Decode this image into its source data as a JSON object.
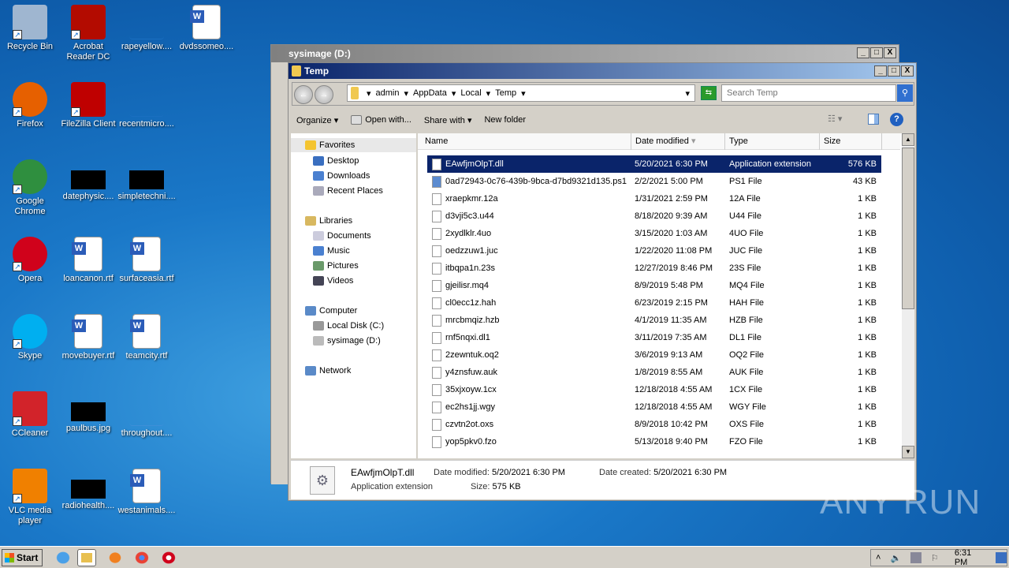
{
  "desktop": {
    "icons": [
      {
        "label": "Recycle Bin",
        "icon": "recycle-bin-icon",
        "color": "#9fb6d0"
      },
      {
        "label": "Acrobat Reader DC",
        "icon": "acrobat-icon",
        "color": "#b30b00"
      },
      {
        "label": "rapeyellow....",
        "icon": "blank-file-icon",
        "color": "#1a6fc0"
      },
      {
        "label": "dvdssomeo....",
        "icon": "word-doc-icon",
        "color": "#ffffff"
      },
      {
        "label": "Firefox",
        "icon": "firefox-icon",
        "color": "#e66000"
      },
      {
        "label": "FileZilla Client",
        "icon": "filezilla-icon",
        "color": "#bf0000"
      },
      {
        "label": "recentmicro....",
        "icon": "blank-file-icon",
        "color": "#1a6fc0"
      },
      {
        "label": "Google Chrome",
        "icon": "chrome-icon",
        "color": "#2f8f3f"
      },
      {
        "label": "datephysic....",
        "icon": "black-thumb-icon",
        "color": "#000000"
      },
      {
        "label": "simpletechni....",
        "icon": "black-thumb-icon",
        "color": "#000000"
      },
      {
        "label": "Opera",
        "icon": "opera-icon",
        "color": "#d0021b"
      },
      {
        "label": "loancanon.rtf",
        "icon": "word-doc-icon",
        "color": "#ffffff"
      },
      {
        "label": "surfaceasia.rtf",
        "icon": "word-doc-icon",
        "color": "#ffffff"
      },
      {
        "label": "Skype",
        "icon": "skype-icon",
        "color": "#00aff0"
      },
      {
        "label": "movebuyer.rtf",
        "icon": "word-doc-icon",
        "color": "#ffffff"
      },
      {
        "label": "teamcity.rtf",
        "icon": "word-doc-icon",
        "color": "#ffffff"
      },
      {
        "label": "CCleaner",
        "icon": "ccleaner-icon",
        "color": "#d2232a"
      },
      {
        "label": "paulbus.jpg",
        "icon": "black-thumb-icon",
        "color": "#000000"
      },
      {
        "label": "throughout....",
        "icon": "blank-file-icon",
        "color": "#3d8fd8"
      },
      {
        "label": "VLC media player",
        "icon": "vlc-icon",
        "color": "#f08000"
      },
      {
        "label": "radiohealth....",
        "icon": "black-thumb-icon",
        "color": "#000000"
      },
      {
        "label": "westanimals....",
        "icon": "word-doc-icon",
        "color": "#ffffff"
      }
    ]
  },
  "back_window": {
    "title": "sysimage (D:)"
  },
  "window": {
    "title": "Temp",
    "breadcrumb": [
      "admin",
      "AppData",
      "Local",
      "Temp"
    ],
    "search_placeholder": "Search Temp",
    "toolbar": {
      "organize": "Organize",
      "open_with": "Open with...",
      "share_with": "Share with",
      "new_folder": "New folder"
    },
    "nav": {
      "favorites": "Favorites",
      "desktop": "Desktop",
      "downloads": "Downloads",
      "recent": "Recent Places",
      "libraries": "Libraries",
      "documents": "Documents",
      "music": "Music",
      "pictures": "Pictures",
      "videos": "Videos",
      "computer": "Computer",
      "local_disk": "Local Disk (C:)",
      "sysimage": "sysimage (D:)",
      "network": "Network"
    },
    "columns": {
      "name": "Name",
      "date": "Date modified",
      "type": "Type",
      "size": "Size"
    },
    "files": [
      [
        "EAwfjmOlpT.dll",
        "5/20/2021 6:30 PM",
        "Application extension",
        "576 KB"
      ],
      [
        "0ad72943-0c76-439b-9bca-d7bd9321d135.ps1",
        "2/2/2021 5:00 PM",
        "PS1 File",
        "43 KB"
      ],
      [
        "xraepkmr.12a",
        "1/31/2021 2:59 PM",
        "12A File",
        "1 KB"
      ],
      [
        "d3vji5c3.u44",
        "8/18/2020 9:39 AM",
        "U44 File",
        "1 KB"
      ],
      [
        "2xydlklr.4uo",
        "3/15/2020 1:03 AM",
        "4UO File",
        "1 KB"
      ],
      [
        "oedzzuw1.juc",
        "1/22/2020 11:08 PM",
        "JUC File",
        "1 KB"
      ],
      [
        "itbqpa1n.23s",
        "12/27/2019 8:46 PM",
        "23S File",
        "1 KB"
      ],
      [
        "gjeilisr.mq4",
        "8/9/2019 5:48 PM",
        "MQ4 File",
        "1 KB"
      ],
      [
        "cl0ecc1z.hah",
        "6/23/2019 2:15 PM",
        "HAH File",
        "1 KB"
      ],
      [
        "mrcbmqiz.hzb",
        "4/1/2019 11:35 AM",
        "HZB File",
        "1 KB"
      ],
      [
        "rnf5nqxi.dl1",
        "3/11/2019 7:35 AM",
        "DL1 File",
        "1 KB"
      ],
      [
        "2zewntuk.oq2",
        "3/6/2019 9:13 AM",
        "OQ2 File",
        "1 KB"
      ],
      [
        "y4znsfuw.auk",
        "1/8/2019 8:55 AM",
        "AUK File",
        "1 KB"
      ],
      [
        "35xjxoyw.1cx",
        "12/18/2018 4:55 AM",
        "1CX File",
        "1 KB"
      ],
      [
        "ec2hs1jj.wgy",
        "12/18/2018 4:55 AM",
        "WGY File",
        "1 KB"
      ],
      [
        "czvtn2ot.oxs",
        "8/9/2018 10:42 PM",
        "OXS File",
        "1 KB"
      ],
      [
        "yop5pkv0.fzo",
        "5/13/2018 9:40 PM",
        "FZO File",
        "1 KB"
      ]
    ],
    "details": {
      "name": "EAwfjmOlpT.dll",
      "type": "Application extension",
      "date_modified_label": "Date modified:",
      "date_modified": "5/20/2021 6:30 PM",
      "size_label": "Size:",
      "size": "575 KB",
      "date_created_label": "Date created:",
      "date_created": "5/20/2021 6:30 PM"
    }
  },
  "taskbar": {
    "start": "Start",
    "clock": "6:31 PM"
  },
  "watermark": "ANY RUN"
}
